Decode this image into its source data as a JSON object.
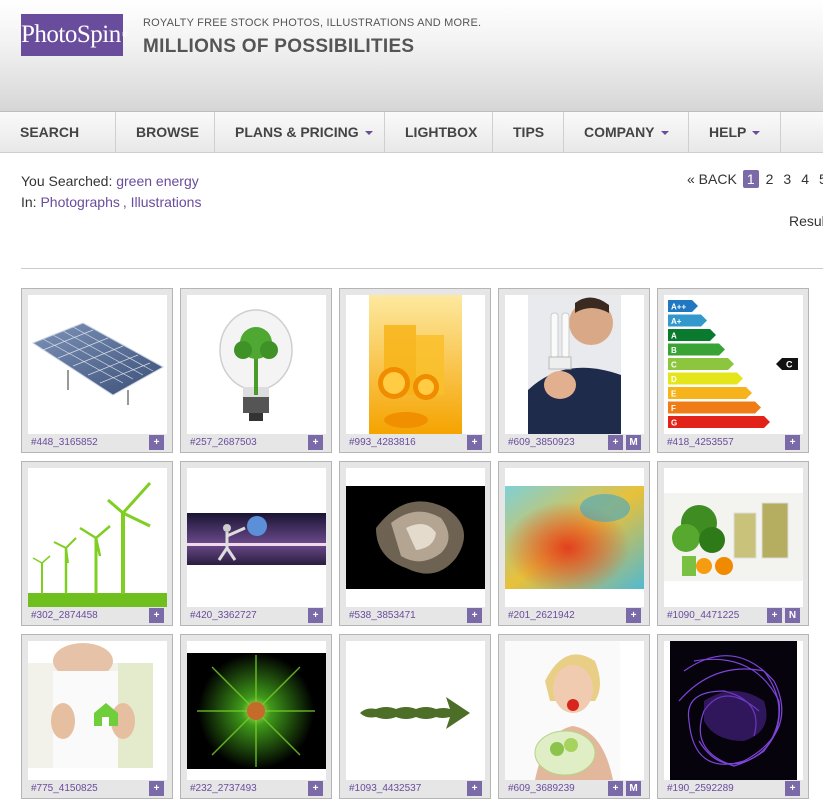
{
  "header": {
    "logo_text": "PhotoSpin",
    "logo_mark": "®",
    "tagline": "ROYALTY FREE STOCK PHOTOS, ILLUSTRATIONS AND MORE.",
    "slogan": "MILLIONS OF POSSIBILITIES"
  },
  "nav": {
    "items": [
      {
        "label": "SEARCH",
        "has_dropdown": false
      },
      {
        "label": "BROWSE",
        "has_dropdown": false
      },
      {
        "label": "PLANS & PRICING",
        "has_dropdown": true
      },
      {
        "label": "LIGHTBOX",
        "has_dropdown": false
      },
      {
        "label": "TIPS",
        "has_dropdown": false
      },
      {
        "label": "COMPANY",
        "has_dropdown": true
      },
      {
        "label": "HELP",
        "has_dropdown": true
      }
    ]
  },
  "search": {
    "searched_label": "You Searched:",
    "query": "green energy",
    "in_label": "In:",
    "category_1": "Photographs",
    "separator": ",",
    "category_2": "Illustrations"
  },
  "pager": {
    "back_label": "« BACK",
    "current": "1",
    "pages": [
      "2",
      "3",
      "4",
      "5"
    ]
  },
  "results_label": "Resul",
  "colors": {
    "brand": "#6a4c9c",
    "button": "#7b6aa8"
  },
  "thumbnails": [
    {
      "id": "#448_3165852",
      "subject": "solar-panels",
      "buttons": [
        "+"
      ]
    },
    {
      "id": "#257_2687503",
      "subject": "lightbulb-tree",
      "buttons": [
        "+"
      ]
    },
    {
      "id": "#993_4283816",
      "subject": "orange-juice",
      "buttons": [
        "+"
      ]
    },
    {
      "id": "#609_3850923",
      "subject": "man-cfl-bulb",
      "buttons": [
        "+",
        "M"
      ]
    },
    {
      "id": "#418_4253557",
      "subject": "energy-rating-chart",
      "buttons": [
        "+"
      ]
    },
    {
      "id": "#302_2874458",
      "subject": "wind-turbines",
      "buttons": [
        "+"
      ]
    },
    {
      "id": "#420_3362727",
      "subject": "figure-with-globe",
      "buttons": [
        "+"
      ]
    },
    {
      "id": "#538_3853471",
      "subject": "abstract-fractal",
      "buttons": [
        "+"
      ]
    },
    {
      "id": "#201_2621942",
      "subject": "colorful-abstract",
      "buttons": [
        "+"
      ]
    },
    {
      "id": "#1090_4471225",
      "subject": "green-smoothie",
      "buttons": [
        "+",
        "N"
      ]
    },
    {
      "id": "#775_4150825",
      "subject": "hands-house",
      "buttons": [
        "+"
      ]
    },
    {
      "id": "#232_2737493",
      "subject": "green-light-burst",
      "buttons": [
        "+"
      ]
    },
    {
      "id": "#1093_4432537",
      "subject": "leaf-arrow",
      "buttons": [
        "+"
      ]
    },
    {
      "id": "#609_3689239",
      "subject": "woman-salad",
      "buttons": [
        "+",
        "M"
      ]
    },
    {
      "id": "#190_2592289",
      "subject": "purple-abstract",
      "buttons": [
        "+"
      ]
    }
  ],
  "energy_rating": {
    "classes": [
      "A++",
      "A+",
      "A",
      "B",
      "C",
      "D",
      "E",
      "F",
      "G"
    ],
    "colors": [
      "#1f78c1",
      "#3399cc",
      "#0a7a2f",
      "#3aa335",
      "#8cc63f",
      "#e5e51c",
      "#f6b31b",
      "#f07c18",
      "#e2231a"
    ],
    "marker": "C"
  }
}
